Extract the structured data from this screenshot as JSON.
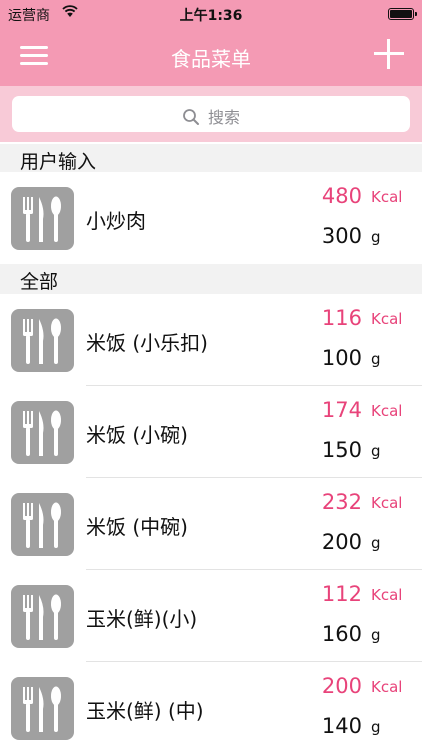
{
  "status": {
    "carrier": "运营商",
    "time": "上午1:36"
  },
  "nav": {
    "title": "食品菜单"
  },
  "search": {
    "placeholder": "搜索"
  },
  "sections": [
    {
      "header": "用户输入",
      "items": [
        {
          "name": "小炒肉",
          "kcal": "480",
          "weight": "300"
        }
      ]
    },
    {
      "header": "全部",
      "items": [
        {
          "name": "米饭 (小乐扣)",
          "kcal": "116",
          "weight": "100"
        },
        {
          "name": "米饭 (小碗)",
          "kcal": "174",
          "weight": "150"
        },
        {
          "name": "米饭 (中碗)",
          "kcal": "232",
          "weight": "200"
        },
        {
          "name": "玉米(鲜)(小)",
          "kcal": "112",
          "weight": "160"
        },
        {
          "name": "玉米(鲜) (中)",
          "kcal": "200",
          "weight": "140"
        }
      ]
    }
  ],
  "units": {
    "kcal": "Kcal",
    "weight": "g"
  },
  "icons": {
    "food": "cutlery-icon",
    "search": "search-icon",
    "menu": "hamburger-menu-icon",
    "add": "plus-icon",
    "wifi": "wifi-icon",
    "battery": "battery-icon"
  },
  "colors": {
    "accent": "#f49ab4",
    "search_band": "#f8cad7",
    "kcal": "#e8437a",
    "icon_bg": "#a0a0a0"
  }
}
